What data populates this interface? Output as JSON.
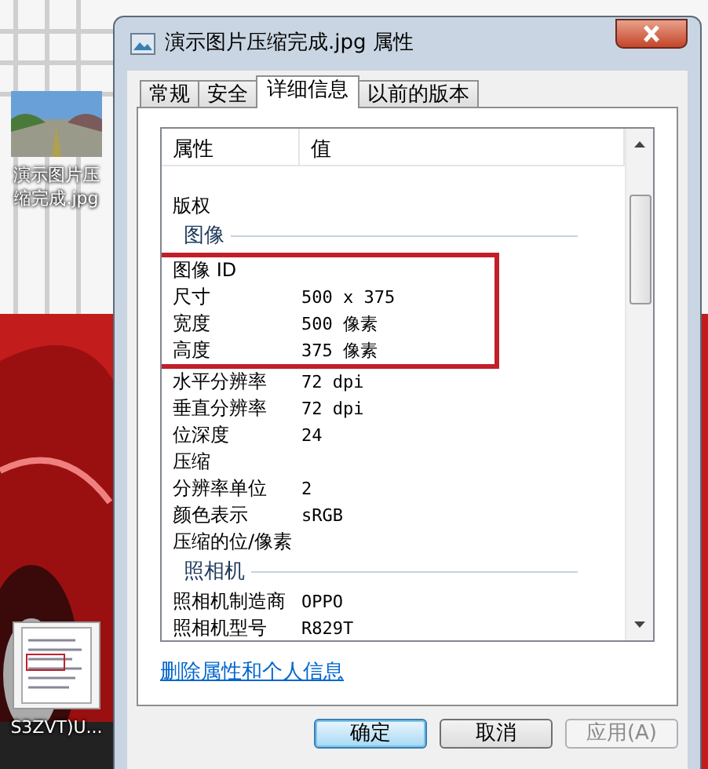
{
  "desktop_icons": [
    {
      "label": "演示图片压缩完成.jpg"
    },
    {
      "label": "S3ZVT)U...",
      "kind": "screenshot"
    }
  ],
  "window": {
    "title": "演示图片压缩完成.jpg 属性"
  },
  "tabs": [
    {
      "label": "常规",
      "selected": false
    },
    {
      "label": "安全",
      "selected": false
    },
    {
      "label": "详细信息",
      "selected": true
    },
    {
      "label": "以前的版本",
      "selected": false
    }
  ],
  "table": {
    "columns": [
      "属性",
      "值"
    ],
    "rows": [
      {
        "kind": "property",
        "name": "版权",
        "value": "",
        "highlighted": false
      },
      {
        "kind": "group",
        "name": "图像"
      },
      {
        "kind": "property",
        "name": "图像 ID",
        "value": "",
        "highlighted": true
      },
      {
        "kind": "property",
        "name": "尺寸",
        "value": "500 x 375",
        "highlighted": true
      },
      {
        "kind": "property",
        "name": "宽度",
        "value": "500 像素",
        "highlighted": true
      },
      {
        "kind": "property",
        "name": "高度",
        "value": "375 像素",
        "highlighted": true
      },
      {
        "kind": "property",
        "name": "水平分辨率",
        "value": "72 dpi",
        "highlighted": false
      },
      {
        "kind": "property",
        "name": "垂直分辨率",
        "value": "72 dpi",
        "highlighted": false
      },
      {
        "kind": "property",
        "name": "位深度",
        "value": "24",
        "highlighted": false
      },
      {
        "kind": "property",
        "name": "压缩",
        "value": "",
        "highlighted": false
      },
      {
        "kind": "property",
        "name": "分辨率单位",
        "value": "2",
        "highlighted": false
      },
      {
        "kind": "property",
        "name": "颜色表示",
        "value": "sRGB",
        "highlighted": false
      },
      {
        "kind": "property",
        "name": "压缩的位/像素",
        "value": "",
        "highlighted": false
      },
      {
        "kind": "group",
        "name": "照相机"
      },
      {
        "kind": "property",
        "name": "照相机制造商",
        "value": "OPPO",
        "highlighted": false
      },
      {
        "kind": "property",
        "name": "照相机型号",
        "value": "R829T",
        "highlighted": false
      }
    ]
  },
  "link": "删除属性和个人信息",
  "buttons": [
    {
      "label": "确定",
      "default": true,
      "disabled": false
    },
    {
      "label": "取消",
      "default": false,
      "disabled": false
    },
    {
      "label": "应用(A)",
      "default": false,
      "disabled": true
    }
  ]
}
